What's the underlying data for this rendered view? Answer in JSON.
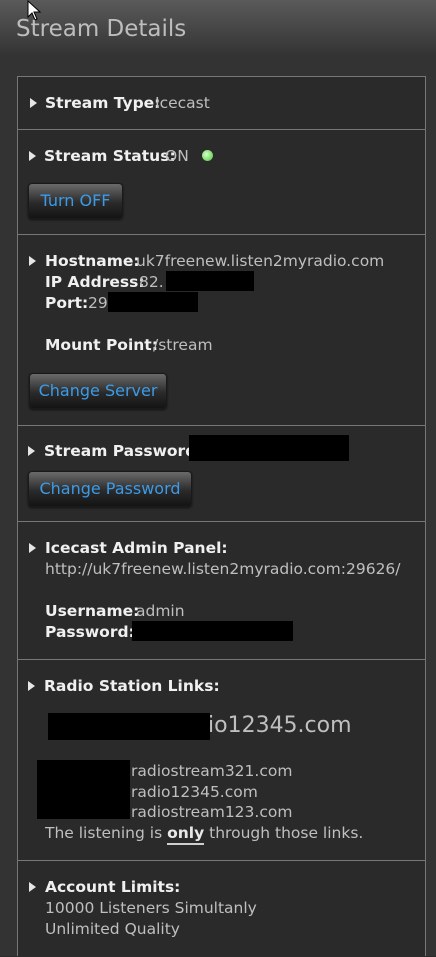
{
  "page_title": "Stream Details",
  "stream_type": {
    "label": "Stream Type:",
    "value": "Icecast"
  },
  "stream_status": {
    "label": "Stream Status:",
    "value": "ON",
    "indicator_color": "#7fdc6a",
    "button_label": "Turn OFF"
  },
  "server": {
    "hostname_label": "Hostname:",
    "hostname": "uk7freenew.listen2myradio.com",
    "ip_label": "IP Address:",
    "ip_visible": "82.",
    "port_label": "Port:",
    "port_visible": "29",
    "mount_label": "Mount Point:",
    "mount": "/stream",
    "button_label": "Change Server"
  },
  "password": {
    "label": "Stream Password:",
    "button_label": "Change Password"
  },
  "admin": {
    "label": "Icecast Admin Panel:",
    "url": "http://uk7freenew.listen2myradio.com:29626/",
    "username_label": "Username:",
    "username": "admin",
    "password_label": "Password:"
  },
  "links": {
    "label": "Radio Station Links:",
    "primary_visible": "io12345.com",
    "items": [
      "radiostream321.com",
      "radio12345.com",
      "radiostream123.com"
    ],
    "note_before": "The listening is",
    "note_emph": "only",
    "note_after": "through those links."
  },
  "limits": {
    "label": "Account Limits:",
    "listeners": "10000 Listeners Simultanly",
    "quality": "Unlimited Quality"
  },
  "colors": {
    "accent": "#3b9be8",
    "background": "#2a2a2a"
  }
}
